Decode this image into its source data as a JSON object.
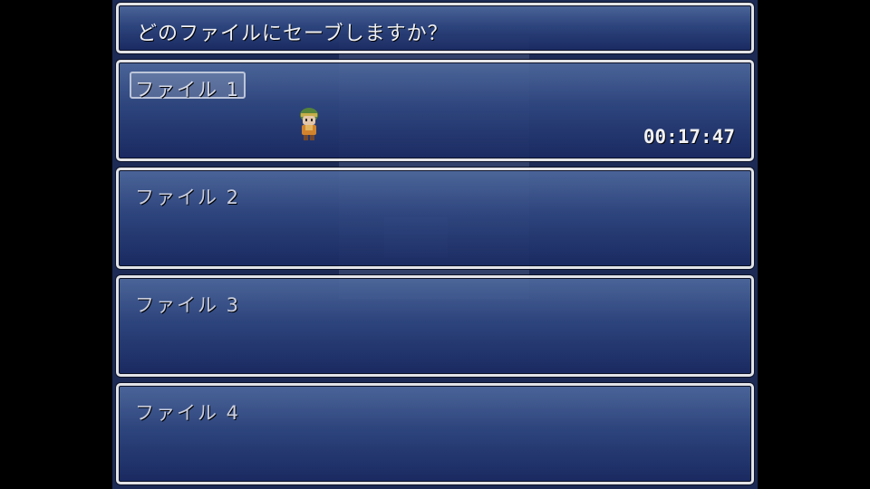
{
  "help": {
    "text": "どのファイルにセーブしますか？"
  },
  "slots": [
    {
      "label": "ファイル 1",
      "playtime": "00:17:47",
      "selected": true,
      "character": "party-leader-sprite"
    },
    {
      "label": "ファイル 2"
    },
    {
      "label": "ファイル 3"
    },
    {
      "label": "ファイル 4"
    }
  ],
  "colors": {
    "window_top": "#4f6a9e",
    "window_bottom": "#1a2a62",
    "frame": "#f2f2f2",
    "text": "#ffffff"
  }
}
